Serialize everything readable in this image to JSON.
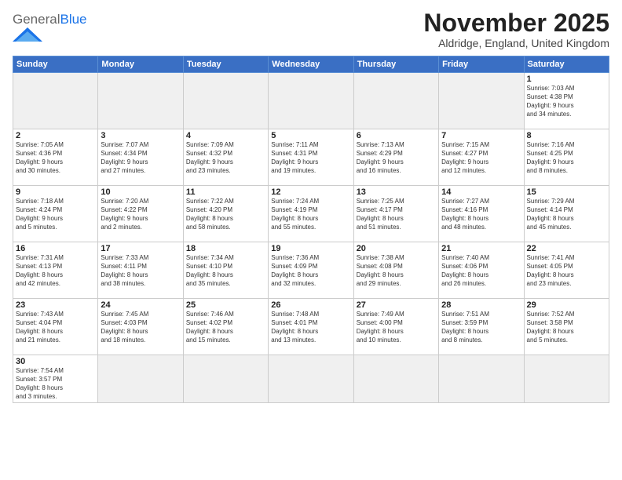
{
  "logo": {
    "text_general": "General",
    "text_blue": "Blue"
  },
  "header": {
    "month": "November 2025",
    "location": "Aldridge, England, United Kingdom"
  },
  "weekdays": [
    "Sunday",
    "Monday",
    "Tuesday",
    "Wednesday",
    "Thursday",
    "Friday",
    "Saturday"
  ],
  "weeks": [
    [
      {
        "day": "",
        "empty": true
      },
      {
        "day": "",
        "empty": true
      },
      {
        "day": "",
        "empty": true
      },
      {
        "day": "",
        "empty": true
      },
      {
        "day": "",
        "empty": true
      },
      {
        "day": "",
        "empty": true
      },
      {
        "day": "1",
        "info": "Sunrise: 7:03 AM\nSunset: 4:38 PM\nDaylight: 9 hours\nand 34 minutes."
      }
    ],
    [
      {
        "day": "2",
        "info": "Sunrise: 7:05 AM\nSunset: 4:36 PM\nDaylight: 9 hours\nand 30 minutes."
      },
      {
        "day": "3",
        "info": "Sunrise: 7:07 AM\nSunset: 4:34 PM\nDaylight: 9 hours\nand 27 minutes."
      },
      {
        "day": "4",
        "info": "Sunrise: 7:09 AM\nSunset: 4:32 PM\nDaylight: 9 hours\nand 23 minutes."
      },
      {
        "day": "5",
        "info": "Sunrise: 7:11 AM\nSunset: 4:31 PM\nDaylight: 9 hours\nand 19 minutes."
      },
      {
        "day": "6",
        "info": "Sunrise: 7:13 AM\nSunset: 4:29 PM\nDaylight: 9 hours\nand 16 minutes."
      },
      {
        "day": "7",
        "info": "Sunrise: 7:15 AM\nSunset: 4:27 PM\nDaylight: 9 hours\nand 12 minutes."
      },
      {
        "day": "8",
        "info": "Sunrise: 7:16 AM\nSunset: 4:25 PM\nDaylight: 9 hours\nand 8 minutes."
      }
    ],
    [
      {
        "day": "9",
        "info": "Sunrise: 7:18 AM\nSunset: 4:24 PM\nDaylight: 9 hours\nand 5 minutes."
      },
      {
        "day": "10",
        "info": "Sunrise: 7:20 AM\nSunset: 4:22 PM\nDaylight: 9 hours\nand 2 minutes."
      },
      {
        "day": "11",
        "info": "Sunrise: 7:22 AM\nSunset: 4:20 PM\nDaylight: 8 hours\nand 58 minutes."
      },
      {
        "day": "12",
        "info": "Sunrise: 7:24 AM\nSunset: 4:19 PM\nDaylight: 8 hours\nand 55 minutes."
      },
      {
        "day": "13",
        "info": "Sunrise: 7:25 AM\nSunset: 4:17 PM\nDaylight: 8 hours\nand 51 minutes."
      },
      {
        "day": "14",
        "info": "Sunrise: 7:27 AM\nSunset: 4:16 PM\nDaylight: 8 hours\nand 48 minutes."
      },
      {
        "day": "15",
        "info": "Sunrise: 7:29 AM\nSunset: 4:14 PM\nDaylight: 8 hours\nand 45 minutes."
      }
    ],
    [
      {
        "day": "16",
        "info": "Sunrise: 7:31 AM\nSunset: 4:13 PM\nDaylight: 8 hours\nand 42 minutes."
      },
      {
        "day": "17",
        "info": "Sunrise: 7:33 AM\nSunset: 4:11 PM\nDaylight: 8 hours\nand 38 minutes."
      },
      {
        "day": "18",
        "info": "Sunrise: 7:34 AM\nSunset: 4:10 PM\nDaylight: 8 hours\nand 35 minutes."
      },
      {
        "day": "19",
        "info": "Sunrise: 7:36 AM\nSunset: 4:09 PM\nDaylight: 8 hours\nand 32 minutes."
      },
      {
        "day": "20",
        "info": "Sunrise: 7:38 AM\nSunset: 4:08 PM\nDaylight: 8 hours\nand 29 minutes."
      },
      {
        "day": "21",
        "info": "Sunrise: 7:40 AM\nSunset: 4:06 PM\nDaylight: 8 hours\nand 26 minutes."
      },
      {
        "day": "22",
        "info": "Sunrise: 7:41 AM\nSunset: 4:05 PM\nDaylight: 8 hours\nand 23 minutes."
      }
    ],
    [
      {
        "day": "23",
        "info": "Sunrise: 7:43 AM\nSunset: 4:04 PM\nDaylight: 8 hours\nand 21 minutes."
      },
      {
        "day": "24",
        "info": "Sunrise: 7:45 AM\nSunset: 4:03 PM\nDaylight: 8 hours\nand 18 minutes."
      },
      {
        "day": "25",
        "info": "Sunrise: 7:46 AM\nSunset: 4:02 PM\nDaylight: 8 hours\nand 15 minutes."
      },
      {
        "day": "26",
        "info": "Sunrise: 7:48 AM\nSunset: 4:01 PM\nDaylight: 8 hours\nand 13 minutes."
      },
      {
        "day": "27",
        "info": "Sunrise: 7:49 AM\nSunset: 4:00 PM\nDaylight: 8 hours\nand 10 minutes."
      },
      {
        "day": "28",
        "info": "Sunrise: 7:51 AM\nSunset: 3:59 PM\nDaylight: 8 hours\nand 8 minutes."
      },
      {
        "day": "29",
        "info": "Sunrise: 7:52 AM\nSunset: 3:58 PM\nDaylight: 8 hours\nand 5 minutes."
      }
    ],
    [
      {
        "day": "30",
        "info": "Sunrise: 7:54 AM\nSunset: 3:57 PM\nDaylight: 8 hours\nand 3 minutes."
      },
      {
        "day": "",
        "empty": true
      },
      {
        "day": "",
        "empty": true
      },
      {
        "day": "",
        "empty": true
      },
      {
        "day": "",
        "empty": true
      },
      {
        "day": "",
        "empty": true
      },
      {
        "day": "",
        "empty": true
      }
    ]
  ]
}
